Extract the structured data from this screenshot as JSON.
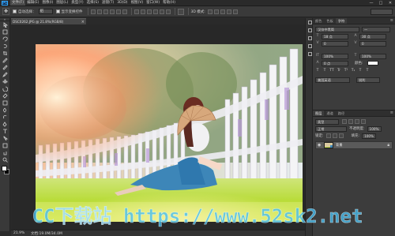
{
  "app": {
    "logo_text": "Ps"
  },
  "menubar": {
    "items": [
      {
        "label": "文件(F)",
        "active": true
      },
      {
        "label": "编辑(E)"
      },
      {
        "label": "图像(I)"
      },
      {
        "label": "图层(L)"
      },
      {
        "label": "类型(Y)"
      },
      {
        "label": "选择(S)"
      },
      {
        "label": "滤镜(T)"
      },
      {
        "label": "3D(D)"
      },
      {
        "label": "视图(V)"
      },
      {
        "label": "窗口(W)"
      },
      {
        "label": "帮助(H)"
      }
    ],
    "window_buttons": [
      "—",
      "□",
      "✕"
    ]
  },
  "options": {
    "auto_select_label": "自动选择：",
    "auto_select_value": "组",
    "show_transform_label": "显示变换控件"
  },
  "tools": [
    "move-tool",
    "marquee-tool",
    "lasso-tool",
    "quick-select-tool",
    "crop-tool",
    "eyedropper-tool",
    "healing-tool",
    "brush-tool",
    "clone-stamp-tool",
    "history-brush-tool",
    "eraser-tool",
    "gradient-tool",
    "blur-tool",
    "dodge-tool",
    "pen-tool",
    "type-tool",
    "path-select-tool",
    "shape-tool",
    "hand-tool",
    "zoom-tool"
  ],
  "colors": {
    "foreground": "#ffffff",
    "background": "#000000",
    "accent": "#31a8ff"
  },
  "document": {
    "tab_label": "DSC0262.JPG @ 21.8%(RGB/8)",
    "close_glyph": "×"
  },
  "status": {
    "zoom": "21.9%",
    "doc_size": "文档:19.0M/34.0M"
  },
  "panels": {
    "top_tabs": [
      "颜色",
      "色板",
      "字符"
    ],
    "character": {
      "font_family": "汉仪中黑简",
      "font_style": "—",
      "font_size": "18 点",
      "leading": "30 点",
      "kerning": "0",
      "tracking": "0",
      "vertical_scale": "100%",
      "horizontal_scale": "100%",
      "baseline": "0 点",
      "color_label": "颜色:",
      "type_styles": [
        "T",
        "T",
        "TT",
        "Tr",
        "T¹",
        "T₁",
        "T",
        "T"
      ],
      "language": "美国英语",
      "antialias": "锐利"
    },
    "layers": {
      "tabs": [
        "图层",
        "通道",
        "路径"
      ],
      "kind_label": "类型",
      "blend_mode": "正常",
      "opacity_label": "不透明度:",
      "opacity": "100%",
      "lock_label": "锁定:",
      "fill_label": "填充:",
      "fill": "100%",
      "layer_name": "背景"
    }
  },
  "watermark": {
    "text": "CC下载站 https://www.52sk2.net"
  }
}
